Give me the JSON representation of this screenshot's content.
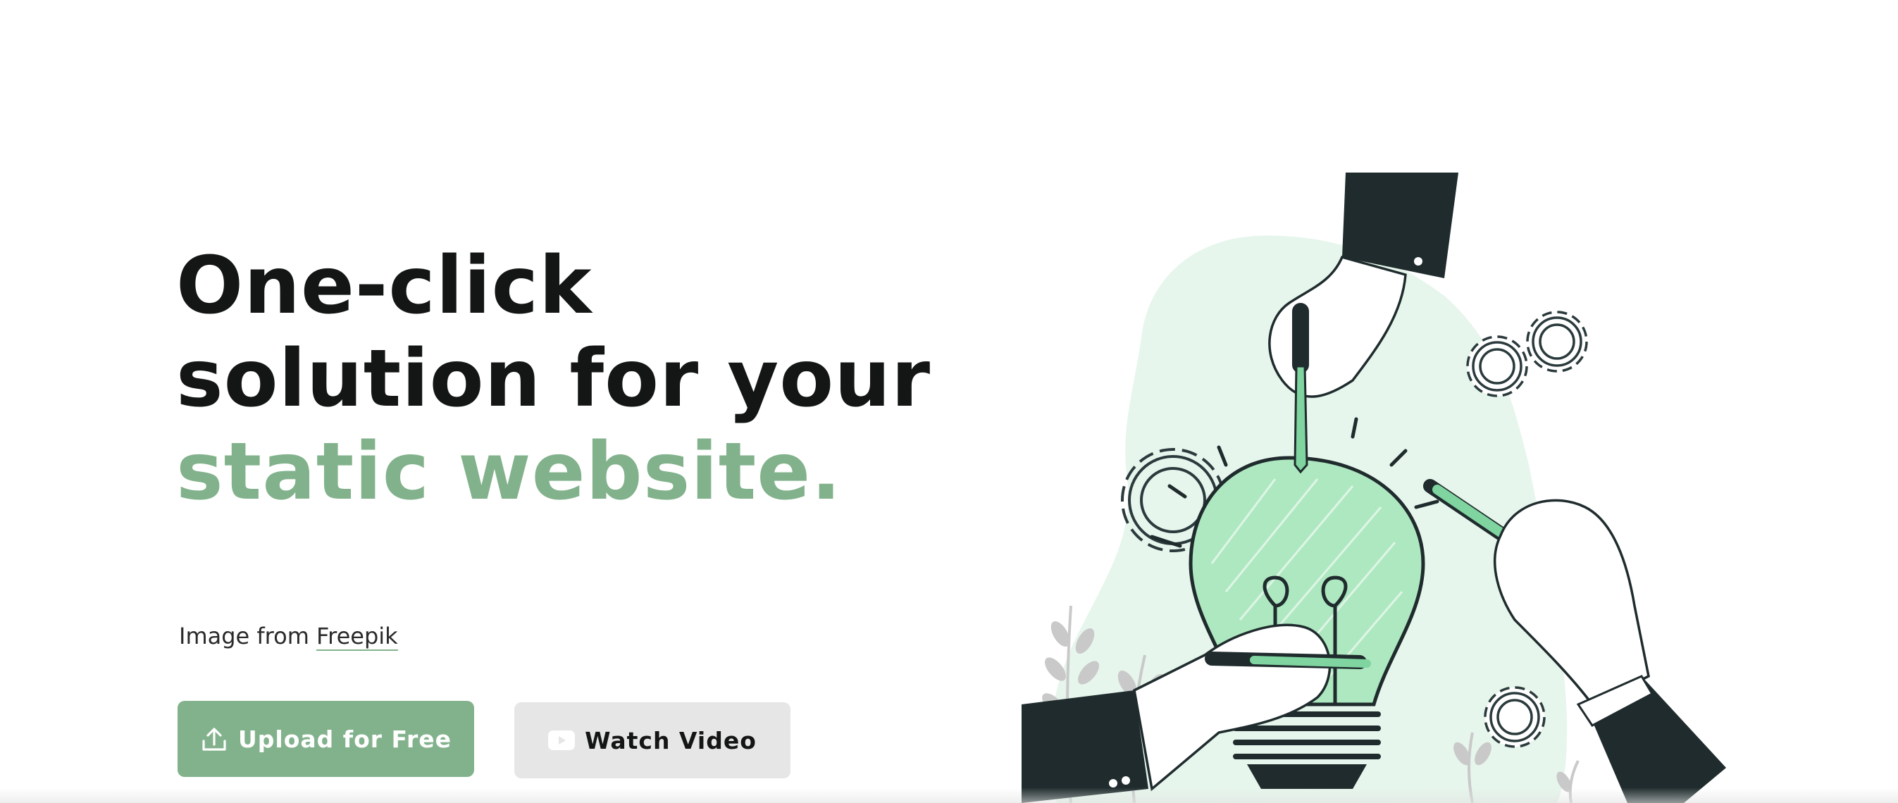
{
  "hero": {
    "title_line1": "One-click",
    "title_line2": "solution for your",
    "title_line3": "static website."
  },
  "credit": {
    "prefix": "Image from ",
    "link_text": "Freepik"
  },
  "buttons": {
    "upload_label": "Upload for Free",
    "watch_label": "Watch Video"
  },
  "icons": {
    "upload": "upload-icon",
    "video": "youtube-icon"
  },
  "colors": {
    "accent": "#82b28c",
    "dark": "#141616",
    "light_button": "#e6e6e6",
    "blob": "#e6f6ec",
    "sleeve": "#1f2b2d",
    "pen_green": "#7fd4a0"
  }
}
